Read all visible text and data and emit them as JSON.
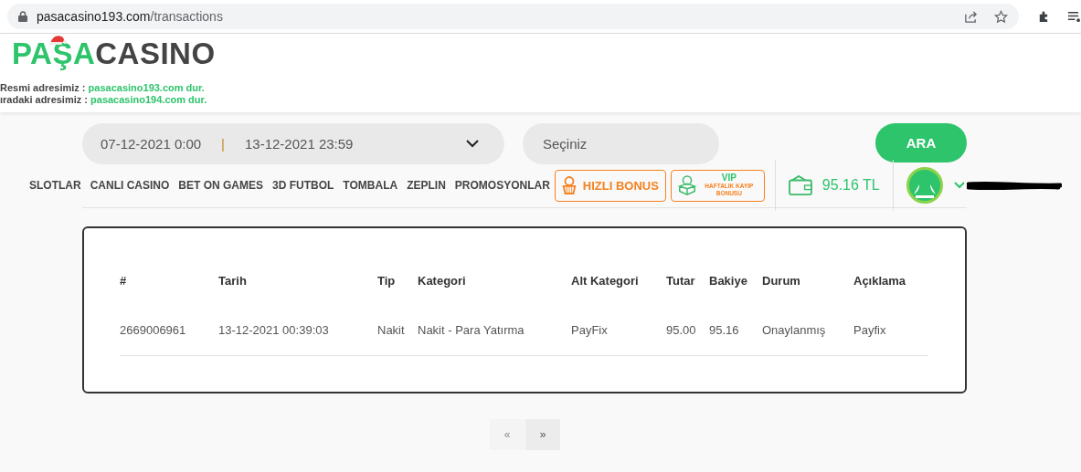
{
  "browser": {
    "url_host": "pasacasino193.com",
    "url_path": "/transactions"
  },
  "logo": {
    "part_1": "PAŞA",
    "part_2": "CASINO"
  },
  "notices": [
    {
      "label": "Resmi adresimiz :",
      "link": "pasacasino193.com dur."
    },
    {
      "label": "ıradaki adresimiz :",
      "link": "pasacasino194.com dur."
    }
  ],
  "filter": {
    "date_from": "07-12-2021 0:00",
    "separator": "|",
    "date_to": "13-12-2021 23:59",
    "select_placeholder": "Seçiniz",
    "search_button": "ARA"
  },
  "nav": [
    "SLOTLAR",
    "CANLI CASINO",
    "BET ON GAMES",
    "3D FUTBOL",
    "TOMBALA",
    "ZEPLIN",
    "PROMOSYONLAR"
  ],
  "bonus_buttons": [
    {
      "kind": "fast",
      "label": "HIZLI BONUS"
    },
    {
      "kind": "vip",
      "badge": "VIP",
      "label": "HAFTALIK KAYIP BONUSU"
    }
  ],
  "balance": "95.16 TL",
  "table": {
    "columns": [
      "#",
      "Tarih",
      "Tip",
      "Kategori",
      "Alt Kategori",
      "Tutar",
      "Bakiye",
      "Durum",
      "Açıklama"
    ],
    "rows": [
      [
        "2669006961",
        "13-12-2021 00:39:03",
        "Nakit",
        "Nakit - Para Yatırma",
        "PayFix",
        "95.00",
        "95.16",
        "Onaylanmış",
        "Payfix"
      ]
    ]
  },
  "pagination": [
    {
      "label": "«",
      "disabled": true
    },
    {
      "label": "»",
      "disabled": false
    }
  ]
}
